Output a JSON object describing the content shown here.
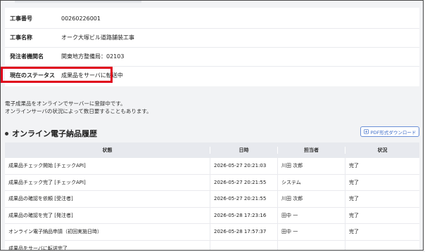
{
  "info": {
    "rows": [
      {
        "label": "工事番号",
        "value": "00260226001"
      },
      {
        "label": "工事名称",
        "value": "オーク大塚ビル道路舗装工事"
      },
      {
        "label": "発注者機関名",
        "value": "関東地方整備局：02103"
      },
      {
        "label": "現在のステータス",
        "value": "成果品をサーバに転送中"
      }
    ],
    "highlight_color": "#e0001b"
  },
  "messages": [
    "電子成果品をオンラインでサーバーに登録中です。",
    "オンラインサーバの状況によって数日要することもあります。"
  ],
  "history": {
    "title": "オンライン電子納品履歴",
    "pdf_button": "PDF形式ダウンロード",
    "columns": [
      "状態",
      "日時",
      "担当者",
      "状況"
    ],
    "rows": [
      {
        "state": "成果品チェック開始 [チェックAPI]",
        "datetime": "2026-05-27 20:21:03",
        "person": "川田 次郎",
        "status": "完了"
      },
      {
        "state": "成果品チェック完了 [チェックAPI]",
        "datetime": "2026-05-27 20:21:55",
        "person": "システム",
        "status": "完了"
      },
      {
        "state": "成果品の確認を依頼 [受注者]",
        "datetime": "2026-05-27 20:21:55",
        "person": "川田 次郎",
        "status": "完了"
      },
      {
        "state": "成果品の確認を完了 [発注者]",
        "datetime": "2026-05-28 17:23:16",
        "person": "田中 一",
        "status": "完了"
      },
      {
        "state": "オンライン電子納品申請（初回実施日時）",
        "datetime": "2026-05-28 17:57:37",
        "person": "田中 一",
        "status": "完了"
      },
      {
        "state": "成果品をサーバに転送完了",
        "datetime": "",
        "person": "",
        "status": ""
      }
    ]
  }
}
